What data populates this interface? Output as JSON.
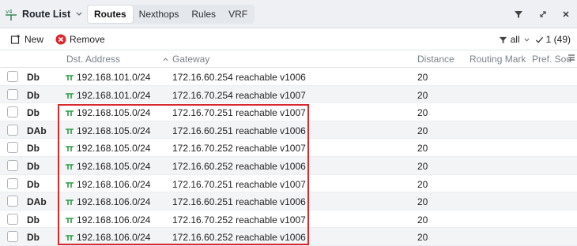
{
  "window": {
    "title": "Route List",
    "tabs": [
      {
        "label": "Routes",
        "active": true
      },
      {
        "label": "Nexthops",
        "active": false
      },
      {
        "label": "Rules",
        "active": false
      },
      {
        "label": "VRF",
        "active": false
      }
    ]
  },
  "toolbar": {
    "new_label": "New",
    "remove_label": "Remove",
    "filter_label": "all",
    "count_label": "1 (49)"
  },
  "columns": {
    "dst": "Dst. Address",
    "gateway": "Gateway",
    "distance": "Distance",
    "routing_mark": "Routing Mark",
    "pref_source": "Pref. Sou"
  },
  "rows": [
    {
      "flags": "Db",
      "dst": "192.168.101.0/24",
      "gateway": "172.16.60.254 reachable v1006",
      "distance": "20"
    },
    {
      "flags": "Db",
      "dst": "192.168.101.0/24",
      "gateway": "172.16.70.254 reachable v1007",
      "distance": "20"
    },
    {
      "flags": "Db",
      "dst": "192.168.105.0/24",
      "gateway": "172.16.70.251 reachable v1007",
      "distance": "20"
    },
    {
      "flags": "DAb",
      "dst": "192.168.105.0/24",
      "gateway": "172.16.60.251 reachable v1006",
      "distance": "20"
    },
    {
      "flags": "Db",
      "dst": "192.168.105.0/24",
      "gateway": "172.16.70.252 reachable v1007",
      "distance": "20"
    },
    {
      "flags": "Db",
      "dst": "192.168.105.0/24",
      "gateway": "172.16.60.252 reachable v1006",
      "distance": "20"
    },
    {
      "flags": "Db",
      "dst": "192.168.106.0/24",
      "gateway": "172.16.70.251 reachable v1007",
      "distance": "20"
    },
    {
      "flags": "DAb",
      "dst": "192.168.106.0/24",
      "gateway": "172.16.60.251 reachable v1006",
      "distance": "20"
    },
    {
      "flags": "Db",
      "dst": "192.168.106.0/24",
      "gateway": "172.16.70.252 reachable v1007",
      "distance": "20"
    },
    {
      "flags": "Db",
      "dst": "192.168.106.0/24",
      "gateway": "172.16.60.252 reachable v1006",
      "distance": "20"
    }
  ],
  "colors": {
    "route_icon": "#2e9a47",
    "remove_icon": "#d9272e",
    "highlight_border": "#d9272e"
  }
}
